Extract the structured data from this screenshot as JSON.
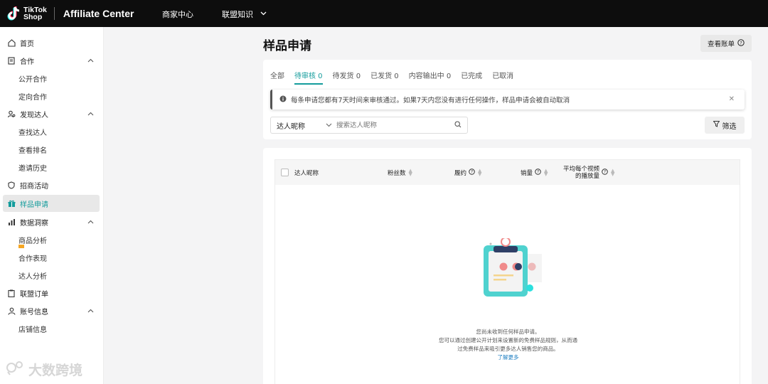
{
  "header": {
    "logo_line1": "TikTok",
    "logo_line2": "Shop",
    "app_title": "Affiliate Center",
    "nav": [
      "商家中心",
      "联盟知识"
    ]
  },
  "sidebar": {
    "items": [
      {
        "label": "首页",
        "icon": "home-icon"
      },
      {
        "label": "合作",
        "icon": "document-icon"
      },
      {
        "label": "公开合作"
      },
      {
        "label": "定向合作"
      },
      {
        "label": "发现达人",
        "icon": "user-search-icon"
      },
      {
        "label": "查找达人"
      },
      {
        "label": "查看排名"
      },
      {
        "label": "邀请历史"
      },
      {
        "label": "招商活动",
        "icon": "shield-icon"
      },
      {
        "label": "样品申请",
        "icon": "gift-icon"
      },
      {
        "label": "数据洞察",
        "icon": "bar-chart-icon"
      },
      {
        "label": "商品分析"
      },
      {
        "label": "合作表现"
      },
      {
        "label": "达人分析"
      },
      {
        "label": "联盟订单",
        "icon": "clipboard-icon"
      },
      {
        "label": "账号信息",
        "icon": "user-icon"
      },
      {
        "label": "店铺信息"
      }
    ],
    "watermark": "大数跨境"
  },
  "main": {
    "title": "样品申请",
    "bill_button": "查看账单",
    "tabs": [
      "全部",
      "待审核 0",
      "待发货 0",
      "已发货 0",
      "内容输出中 0",
      "已完成",
      "已取消"
    ],
    "active_tab": "待审核 0",
    "notice": "每条申请您都有7天时间来审核通过。如果7天内您没有进行任何操作，样品申请会被自动取消",
    "filter": {
      "select_value": "达人昵称",
      "search_placeholder": "搜索达人昵称",
      "filter_button": "筛选"
    },
    "table": {
      "columns": [
        "达人昵称",
        "粉丝数",
        "履约",
        "销量",
        "平均每个视频",
        "的播放量"
      ]
    },
    "empty": {
      "line1": "您尚未收到任何样品申请。",
      "line2": "您可以通过创建公开计划来设置新的免费样品规则，从而通",
      "line3": "过免费样品来吸引更多达人销售您的商品。",
      "link": "了解更多"
    }
  },
  "colors": {
    "accent": "#149c9c",
    "topbar": "#0d0d0d",
    "link": "#1f7fc2"
  }
}
